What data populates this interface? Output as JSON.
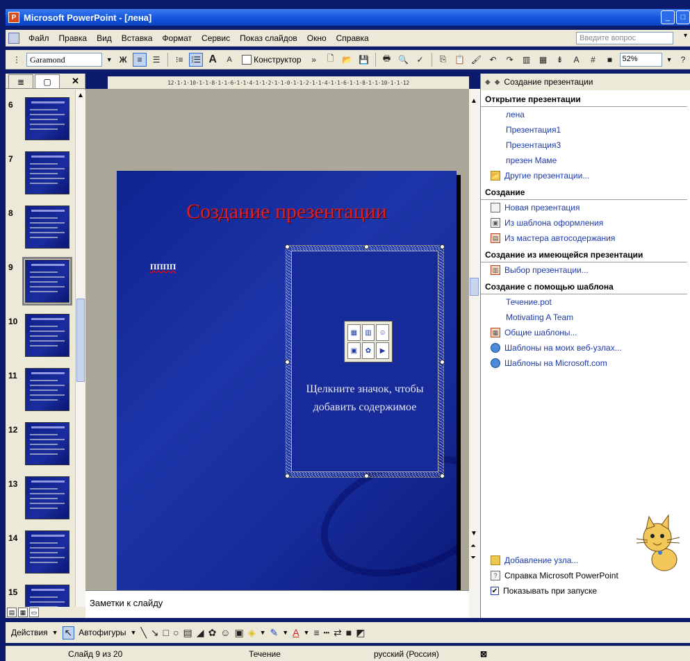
{
  "window": {
    "title": "Microsoft PowerPoint - [лена]",
    "app_icon": "powerpoint-icon"
  },
  "menu": {
    "items": [
      "Файл",
      "Правка",
      "Вид",
      "Вставка",
      "Формат",
      "Сервис",
      "Показ слайдов",
      "Окно",
      "Справка"
    ],
    "question_placeholder": "Введите вопрос"
  },
  "toolbar": {
    "font": "Garamond",
    "bold": "Ж",
    "font_grow": "A",
    "font_shrink": "A",
    "designer": "Конструктор",
    "zoom": "52%",
    "help": "?"
  },
  "thumbnails": {
    "numbers": [
      "6",
      "7",
      "8",
      "9",
      "10",
      "11",
      "12",
      "13",
      "14",
      "15"
    ],
    "selected": "9"
  },
  "ruler": {
    "text": "12·1·1·10·1·1·8·1·1·6·1·1·4·1·1·2·1·1·0·1·1·2·1·1·4·1·1·6·1·1·8·1·1·10·1·1·12"
  },
  "slide": {
    "title": "Создание презентации",
    "small_text": "ПППП",
    "placeholder_text_1": "Щелкните значок, чтобы",
    "placeholder_text_2": "добавить содержимое",
    "title_color": "#d8202a",
    "bg_color": "#1c35a8"
  },
  "notes": {
    "placeholder": "Заметки к слайду"
  },
  "taskpane": {
    "header": "Создание презентации",
    "sections": [
      {
        "title": "Открытие презентации",
        "links": [
          {
            "label": "лена",
            "icon": ""
          },
          {
            "label": "Презентация1",
            "icon": ""
          },
          {
            "label": "Презентация3",
            "icon": ""
          },
          {
            "label": "презен Маме",
            "icon": ""
          },
          {
            "label": "Другие презентации...",
            "icon": "folder-icon"
          }
        ]
      },
      {
        "title": "Создание",
        "links": [
          {
            "label": "Новая презентация",
            "icon": "new-document-icon"
          },
          {
            "label": "Из шаблона оформления",
            "icon": "design-template-icon"
          },
          {
            "label": "Из мастера автосодержания",
            "icon": "autocontent-wizard-icon"
          }
        ]
      },
      {
        "title": "Создание из имеющейся презентации",
        "links": [
          {
            "label": "Выбор презентации...",
            "icon": "choose-presentation-icon"
          }
        ]
      },
      {
        "title": "Создание с помощью шаблона",
        "links": [
          {
            "label": "Течение.pot",
            "icon": ""
          },
          {
            "label": "Motivating A Team",
            "icon": ""
          },
          {
            "label": "Общие шаблоны...",
            "icon": "templates-icon"
          },
          {
            "label": "Шаблоны на моих веб-узлах...",
            "icon": "web-templates-icon"
          },
          {
            "label": "Шаблоны на Microsoft.com",
            "icon": "globe-icon"
          }
        ]
      }
    ],
    "bottom": {
      "add_node": "Добавление узла...",
      "help": "Справка Microsoft PowerPoint",
      "show_on_start": "Показывать при запуске",
      "show_on_start_checked": true
    }
  },
  "drawbar": {
    "actions": "Действия",
    "autoshapes": "Автофигуры"
  },
  "status": {
    "slide": "Слайд 9 из 20",
    "design": "Течение",
    "language": "русский (Россия)"
  }
}
